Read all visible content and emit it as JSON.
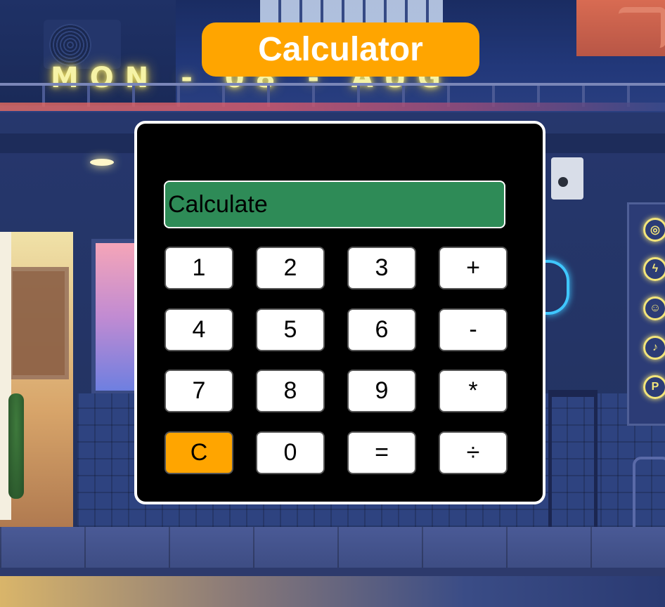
{
  "app": {
    "title": "Calculator"
  },
  "display": {
    "value": "Calculate"
  },
  "keys": {
    "one": "1",
    "two": "2",
    "three": "3",
    "plus": "+",
    "four": "4",
    "five": "5",
    "six": "6",
    "minus": "-",
    "seven": "7",
    "eight": "8",
    "nine": "9",
    "multiply": "*",
    "clear": "C",
    "zero": "0",
    "equals": "=",
    "divide": "÷"
  },
  "colors": {
    "title_background": "#ffa500",
    "display_background": "#2e8b57",
    "clear_key_background": "#ffa500",
    "calculator_background": "#000000"
  },
  "background": {
    "neon_sign": "MON - 08 - AUG",
    "social_icons": [
      "instagram-icon",
      "lightning-icon",
      "reddit-icon",
      "twitter-icon",
      "pinterest-icon"
    ]
  }
}
